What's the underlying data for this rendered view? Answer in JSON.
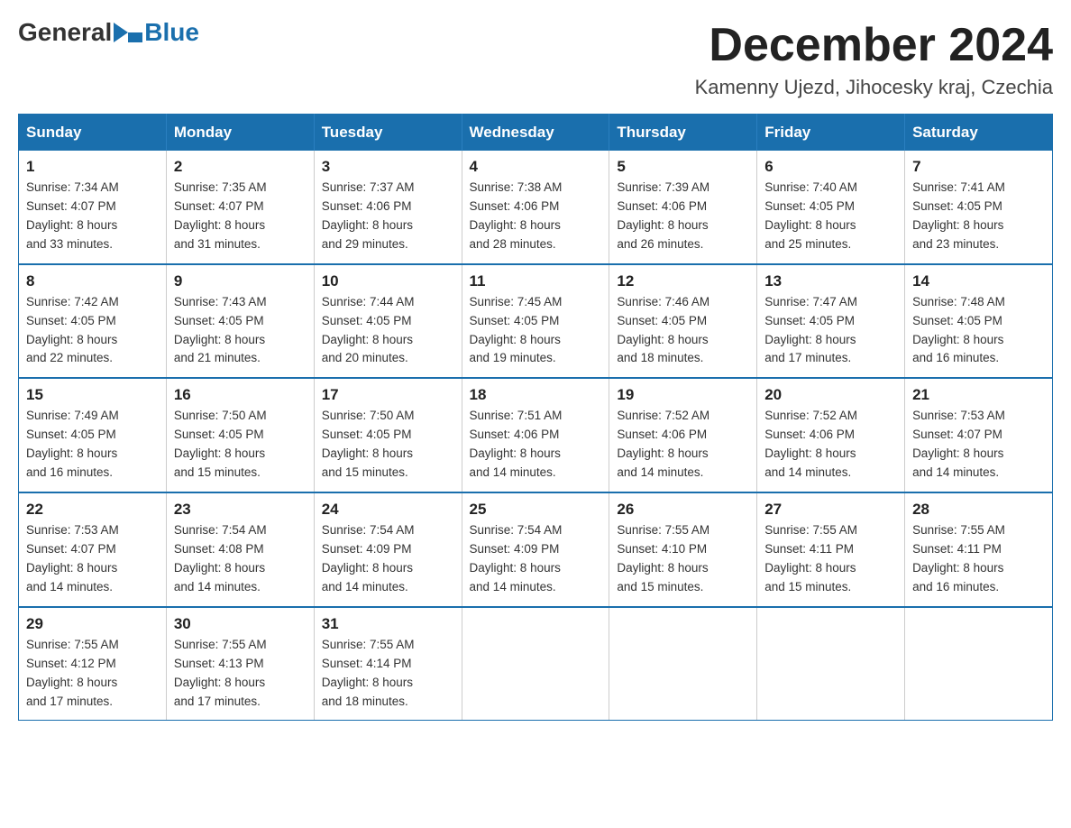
{
  "logo": {
    "general": "General",
    "blue": "Blue"
  },
  "title": "December 2024",
  "location": "Kamenny Ujezd, Jihocesky kraj, Czechia",
  "weekdays": [
    "Sunday",
    "Monday",
    "Tuesday",
    "Wednesday",
    "Thursday",
    "Friday",
    "Saturday"
  ],
  "weeks": [
    [
      {
        "day": "1",
        "sunrise": "7:34 AM",
        "sunset": "4:07 PM",
        "daylight": "8 hours and 33 minutes."
      },
      {
        "day": "2",
        "sunrise": "7:35 AM",
        "sunset": "4:07 PM",
        "daylight": "8 hours and 31 minutes."
      },
      {
        "day": "3",
        "sunrise": "7:37 AM",
        "sunset": "4:06 PM",
        "daylight": "8 hours and 29 minutes."
      },
      {
        "day": "4",
        "sunrise": "7:38 AM",
        "sunset": "4:06 PM",
        "daylight": "8 hours and 28 minutes."
      },
      {
        "day": "5",
        "sunrise": "7:39 AM",
        "sunset": "4:06 PM",
        "daylight": "8 hours and 26 minutes."
      },
      {
        "day": "6",
        "sunrise": "7:40 AM",
        "sunset": "4:05 PM",
        "daylight": "8 hours and 25 minutes."
      },
      {
        "day": "7",
        "sunrise": "7:41 AM",
        "sunset": "4:05 PM",
        "daylight": "8 hours and 23 minutes."
      }
    ],
    [
      {
        "day": "8",
        "sunrise": "7:42 AM",
        "sunset": "4:05 PM",
        "daylight": "8 hours and 22 minutes."
      },
      {
        "day": "9",
        "sunrise": "7:43 AM",
        "sunset": "4:05 PM",
        "daylight": "8 hours and 21 minutes."
      },
      {
        "day": "10",
        "sunrise": "7:44 AM",
        "sunset": "4:05 PM",
        "daylight": "8 hours and 20 minutes."
      },
      {
        "day": "11",
        "sunrise": "7:45 AM",
        "sunset": "4:05 PM",
        "daylight": "8 hours and 19 minutes."
      },
      {
        "day": "12",
        "sunrise": "7:46 AM",
        "sunset": "4:05 PM",
        "daylight": "8 hours and 18 minutes."
      },
      {
        "day": "13",
        "sunrise": "7:47 AM",
        "sunset": "4:05 PM",
        "daylight": "8 hours and 17 minutes."
      },
      {
        "day": "14",
        "sunrise": "7:48 AM",
        "sunset": "4:05 PM",
        "daylight": "8 hours and 16 minutes."
      }
    ],
    [
      {
        "day": "15",
        "sunrise": "7:49 AM",
        "sunset": "4:05 PM",
        "daylight": "8 hours and 16 minutes."
      },
      {
        "day": "16",
        "sunrise": "7:50 AM",
        "sunset": "4:05 PM",
        "daylight": "8 hours and 15 minutes."
      },
      {
        "day": "17",
        "sunrise": "7:50 AM",
        "sunset": "4:05 PM",
        "daylight": "8 hours and 15 minutes."
      },
      {
        "day": "18",
        "sunrise": "7:51 AM",
        "sunset": "4:06 PM",
        "daylight": "8 hours and 14 minutes."
      },
      {
        "day": "19",
        "sunrise": "7:52 AM",
        "sunset": "4:06 PM",
        "daylight": "8 hours and 14 minutes."
      },
      {
        "day": "20",
        "sunrise": "7:52 AM",
        "sunset": "4:06 PM",
        "daylight": "8 hours and 14 minutes."
      },
      {
        "day": "21",
        "sunrise": "7:53 AM",
        "sunset": "4:07 PM",
        "daylight": "8 hours and 14 minutes."
      }
    ],
    [
      {
        "day": "22",
        "sunrise": "7:53 AM",
        "sunset": "4:07 PM",
        "daylight": "8 hours and 14 minutes."
      },
      {
        "day": "23",
        "sunrise": "7:54 AM",
        "sunset": "4:08 PM",
        "daylight": "8 hours and 14 minutes."
      },
      {
        "day": "24",
        "sunrise": "7:54 AM",
        "sunset": "4:09 PM",
        "daylight": "8 hours and 14 minutes."
      },
      {
        "day": "25",
        "sunrise": "7:54 AM",
        "sunset": "4:09 PM",
        "daylight": "8 hours and 14 minutes."
      },
      {
        "day": "26",
        "sunrise": "7:55 AM",
        "sunset": "4:10 PM",
        "daylight": "8 hours and 15 minutes."
      },
      {
        "day": "27",
        "sunrise": "7:55 AM",
        "sunset": "4:11 PM",
        "daylight": "8 hours and 15 minutes."
      },
      {
        "day": "28",
        "sunrise": "7:55 AM",
        "sunset": "4:11 PM",
        "daylight": "8 hours and 16 minutes."
      }
    ],
    [
      {
        "day": "29",
        "sunrise": "7:55 AM",
        "sunset": "4:12 PM",
        "daylight": "8 hours and 17 minutes."
      },
      {
        "day": "30",
        "sunrise": "7:55 AM",
        "sunset": "4:13 PM",
        "daylight": "8 hours and 17 minutes."
      },
      {
        "day": "31",
        "sunrise": "7:55 AM",
        "sunset": "4:14 PM",
        "daylight": "8 hours and 18 minutes."
      },
      null,
      null,
      null,
      null
    ]
  ],
  "labels": {
    "sunrise": "Sunrise:",
    "sunset": "Sunset:",
    "daylight": "Daylight:"
  },
  "colors": {
    "header_bg": "#1a6fad",
    "header_text": "#ffffff",
    "border": "#1a6fad"
  }
}
